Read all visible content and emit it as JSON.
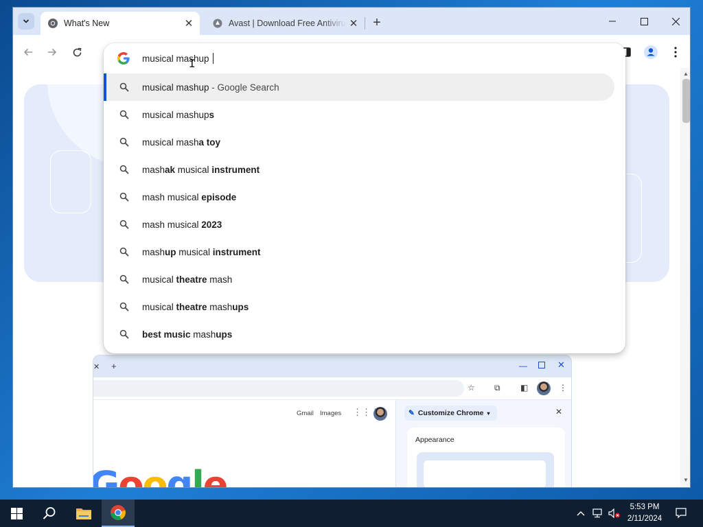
{
  "tabs": [
    {
      "title": "What's New",
      "active": true
    },
    {
      "title": "Avast | Download Free Antivirus",
      "active": false
    }
  ],
  "omnibox": {
    "typed_text": "musical mashup ",
    "suggestions": [
      {
        "parts": [
          {
            "t": "musical mashup",
            "w": "norm"
          },
          {
            "t": " - Google Search",
            "w": "dim"
          }
        ],
        "selected": true
      },
      {
        "parts": [
          {
            "t": "musical mashup",
            "w": "norm"
          },
          {
            "t": "s",
            "w": "bold"
          }
        ]
      },
      {
        "parts": [
          {
            "t": "musical mash",
            "w": "norm"
          },
          {
            "t": "a toy",
            "w": "bold"
          }
        ]
      },
      {
        "parts": [
          {
            "t": "mash",
            "w": "norm"
          },
          {
            "t": "ak",
            "w": "bold"
          },
          {
            "t": " musical ",
            "w": "norm"
          },
          {
            "t": "instrument",
            "w": "bold"
          }
        ]
      },
      {
        "parts": [
          {
            "t": "mash musical ",
            "w": "norm"
          },
          {
            "t": "episode",
            "w": "bold"
          }
        ]
      },
      {
        "parts": [
          {
            "t": "mash musical ",
            "w": "norm"
          },
          {
            "t": "2023",
            "w": "bold"
          }
        ]
      },
      {
        "parts": [
          {
            "t": "mash",
            "w": "norm"
          },
          {
            "t": "up",
            "w": "bold"
          },
          {
            "t": " musical ",
            "w": "norm"
          },
          {
            "t": "instrument",
            "w": "bold"
          }
        ]
      },
      {
        "parts": [
          {
            "t": "musical ",
            "w": "norm"
          },
          {
            "t": "theatre",
            "w": "bold"
          },
          {
            "t": " mash",
            "w": "norm"
          }
        ]
      },
      {
        "parts": [
          {
            "t": "musical ",
            "w": "norm"
          },
          {
            "t": "theatre",
            "w": "bold"
          },
          {
            "t": " mash",
            "w": "norm"
          },
          {
            "t": "ups",
            "w": "bold"
          }
        ]
      },
      {
        "parts": [
          {
            "t": "best music",
            "w": "bold"
          },
          {
            "t": " mash",
            "w": "norm"
          },
          {
            "t": "ups",
            "w": "bold"
          }
        ]
      }
    ]
  },
  "illustration": {
    "gmail": "Gmail",
    "images": "Images",
    "customize": "Customize Chrome",
    "appearance": "Appearance",
    "google_word": "Google"
  },
  "taskbar": {
    "time": "5:53 PM",
    "date": "2/11/2024"
  },
  "colors": {
    "accent": "#0b57d0",
    "tabstrip": "#dce6f7",
    "hero": "#e4ebfb",
    "taskbar": "#0f1f31"
  }
}
